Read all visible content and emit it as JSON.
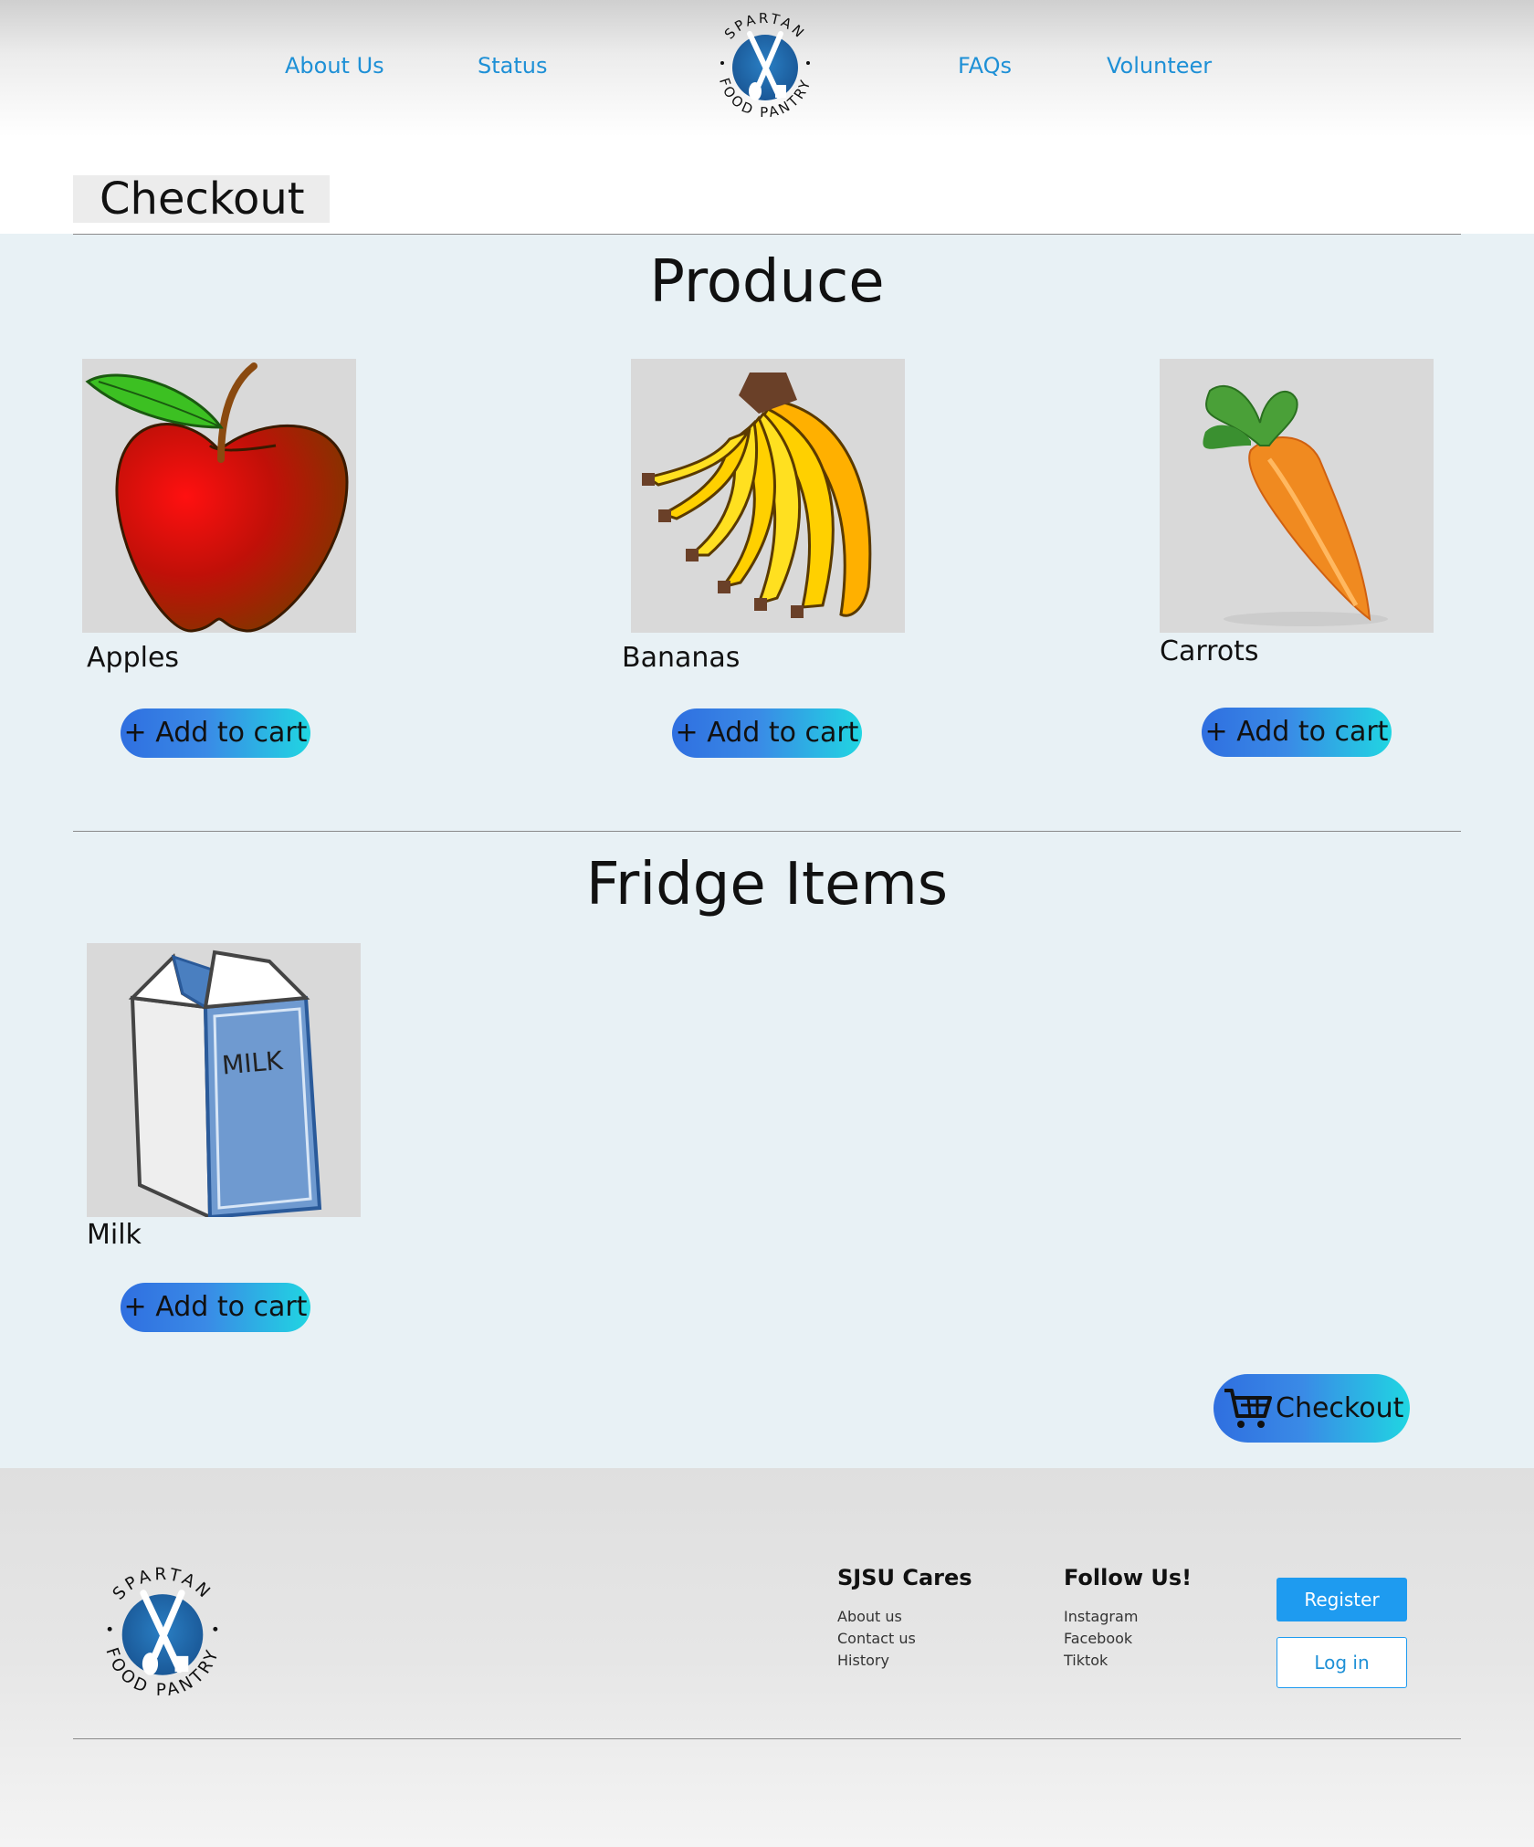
{
  "nav": {
    "about_us": "About Us",
    "status": "Status",
    "faqs": "FAQs",
    "volunteer": "Volunteer",
    "logo_text_top": "SPARTAN",
    "logo_text_bottom": "FOOD PANTRY"
  },
  "page": {
    "title": "Checkout"
  },
  "sections": [
    {
      "title": "Produce",
      "items": [
        {
          "name": "Apples",
          "button": "+ Add to cart",
          "image": "apple"
        },
        {
          "name": "Bananas",
          "button": "+ Add to cart",
          "image": "bananas"
        },
        {
          "name": "Carrots",
          "button": "+ Add to cart",
          "image": "carrot"
        }
      ]
    },
    {
      "title": "Fridge Items",
      "items": [
        {
          "name": "Milk",
          "button": "+ Add to cart",
          "image": "milk",
          "carton_label": "MILK"
        }
      ]
    }
  ],
  "checkout_button": {
    "label": "Checkout",
    "icon": "cart-icon"
  },
  "footer": {
    "col1": {
      "heading": "SJSU Cares",
      "links": [
        "About us",
        "Contact us",
        "History"
      ]
    },
    "col2": {
      "heading": "Follow Us!",
      "links": [
        "Instagram",
        "Facebook",
        "Tiktok"
      ]
    },
    "register": "Register",
    "login": "Log in"
  },
  "colors": {
    "link": "#1e90d6",
    "accent_gradient_start": "#2f6fe0",
    "accent_gradient_end": "#20d6e2",
    "register_bg": "#1e9bf0",
    "main_bg": "#e8f1f5",
    "logo_blue": "#1f5fa0"
  }
}
